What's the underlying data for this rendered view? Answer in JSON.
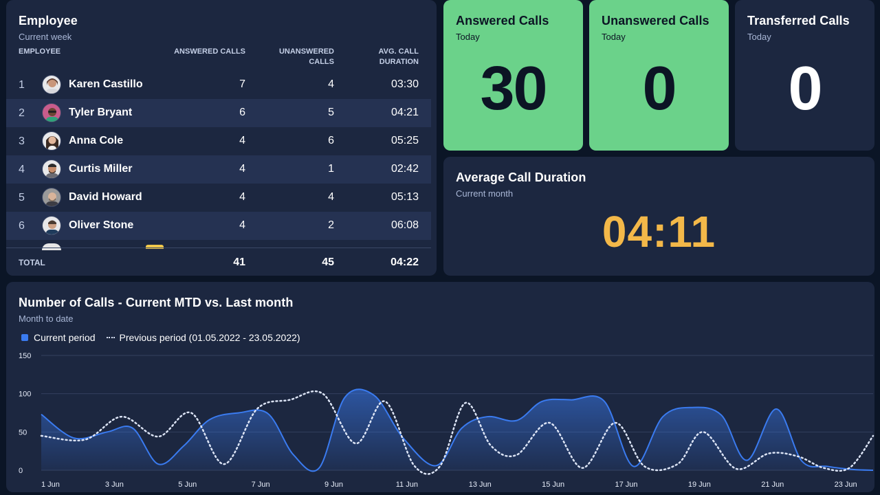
{
  "employee_table": {
    "title": "Employee",
    "subtitle": "Current week",
    "headers": {
      "employee": "EMPLOYEE",
      "answered_l1": "ANSWERED CALLS",
      "unanswered_l1": "UNANSWERED",
      "unanswered_l2": "CALLS",
      "duration_l1": "AVG. CALL",
      "duration_l2": "DURATION"
    },
    "rows": [
      {
        "rank": "1",
        "name": "Karen Castillo",
        "answered": "7",
        "unanswered": "4",
        "duration": "03:30"
      },
      {
        "rank": "2",
        "name": "Tyler Bryant",
        "answered": "6",
        "unanswered": "5",
        "duration": "04:21"
      },
      {
        "rank": "3",
        "name": "Anna Cole",
        "answered": "4",
        "unanswered": "6",
        "duration": "05:25"
      },
      {
        "rank": "4",
        "name": "Curtis Miller",
        "answered": "4",
        "unanswered": "1",
        "duration": "02:42"
      },
      {
        "rank": "5",
        "name": "David Howard",
        "answered": "4",
        "unanswered": "4",
        "duration": "05:13"
      },
      {
        "rank": "6",
        "name": "Oliver Stone",
        "answered": "4",
        "unanswered": "2",
        "duration": "06:08"
      }
    ],
    "total": {
      "label": "TOTAL",
      "answered": "41",
      "unanswered": "45",
      "duration": "04:22"
    }
  },
  "kpis": {
    "answered": {
      "title": "Answered Calls",
      "subtitle": "Today",
      "value": "30"
    },
    "unanswered": {
      "title": "Unanswered Calls",
      "subtitle": "Today",
      "value": "0"
    },
    "transferred": {
      "title": "Transferred Calls",
      "subtitle": "Today",
      "value": "0"
    }
  },
  "avg_duration": {
    "title": "Average Call Duration",
    "subtitle": "Current month",
    "value": "04:11"
  },
  "colors": {
    "background": "#0b1526",
    "card": "#1c2740",
    "green": "#6bd28a",
    "accent_orange": "#f3b849",
    "current_series": "#3a7bf0",
    "previous_series": "#dce4f5"
  },
  "chart_section": {
    "title": "Number of Calls - Current MTD vs. Last month",
    "subtitle": "Month to date"
  },
  "chart_data": {
    "type": "area",
    "title": "Number of Calls - Current MTD vs. Last month",
    "subtitle": "Month to date",
    "ylim": [
      0,
      150
    ],
    "yticks": [
      0,
      50,
      100,
      150
    ],
    "xlim": [
      1,
      23.75
    ],
    "x_tick_labels": [
      "1 Jun",
      "3 Jun",
      "5 Jun",
      "7 Jun",
      "9 Jun",
      "11 Jun",
      "13 Jun",
      "15 Jun",
      "17 Jun",
      "19 Jun",
      "21 Jun",
      "23 Jun"
    ],
    "x_tick_values": [
      1,
      3,
      5,
      7,
      9,
      11,
      13,
      15,
      17,
      19,
      21,
      23
    ],
    "grid": true,
    "legend": "top-left",
    "series": [
      {
        "name": "Current period",
        "style": "area",
        "x": [
          1,
          1.9,
          2.8,
          3.5,
          4.2,
          4.9,
          5.6,
          6.4,
          7.2,
          7.9,
          8.6,
          9.3,
          10.1,
          10.9,
          11.8,
          12.5,
          13.2,
          14,
          14.7,
          15.5,
          16.4,
          17.2,
          18,
          18.8,
          19.6,
          20.3,
          21.1,
          21.8,
          22.5,
          23.2,
          23.75
        ],
        "y": [
          73,
          42,
          50,
          55,
          8,
          32,
          66,
          75,
          74,
          20,
          3,
          95,
          98,
          42,
          6,
          55,
          70,
          65,
          90,
          92,
          90,
          5,
          70,
          82,
          72,
          13,
          80,
          12,
          5,
          1,
          0
        ]
      },
      {
        "name": "Previous period (01.05.2022 - 23.05.2022)",
        "style": "dotted-line",
        "x": [
          1,
          2.2,
          3.2,
          4.2,
          5.1,
          6,
          6.9,
          7.8,
          8.7,
          9.6,
          10.4,
          11.2,
          11.9,
          12.6,
          13.3,
          14,
          14.9,
          15.8,
          16.7,
          17.5,
          18.4,
          19.1,
          20,
          20.9,
          21.7,
          22.4,
          23.1,
          23.75
        ],
        "y": [
          45,
          40,
          70,
          44,
          75,
          8,
          80,
          92,
          100,
          35,
          90,
          6,
          5,
          88,
          32,
          20,
          62,
          3,
          62,
          5,
          8,
          50,
          2,
          22,
          18,
          3,
          3,
          45
        ]
      }
    ]
  }
}
